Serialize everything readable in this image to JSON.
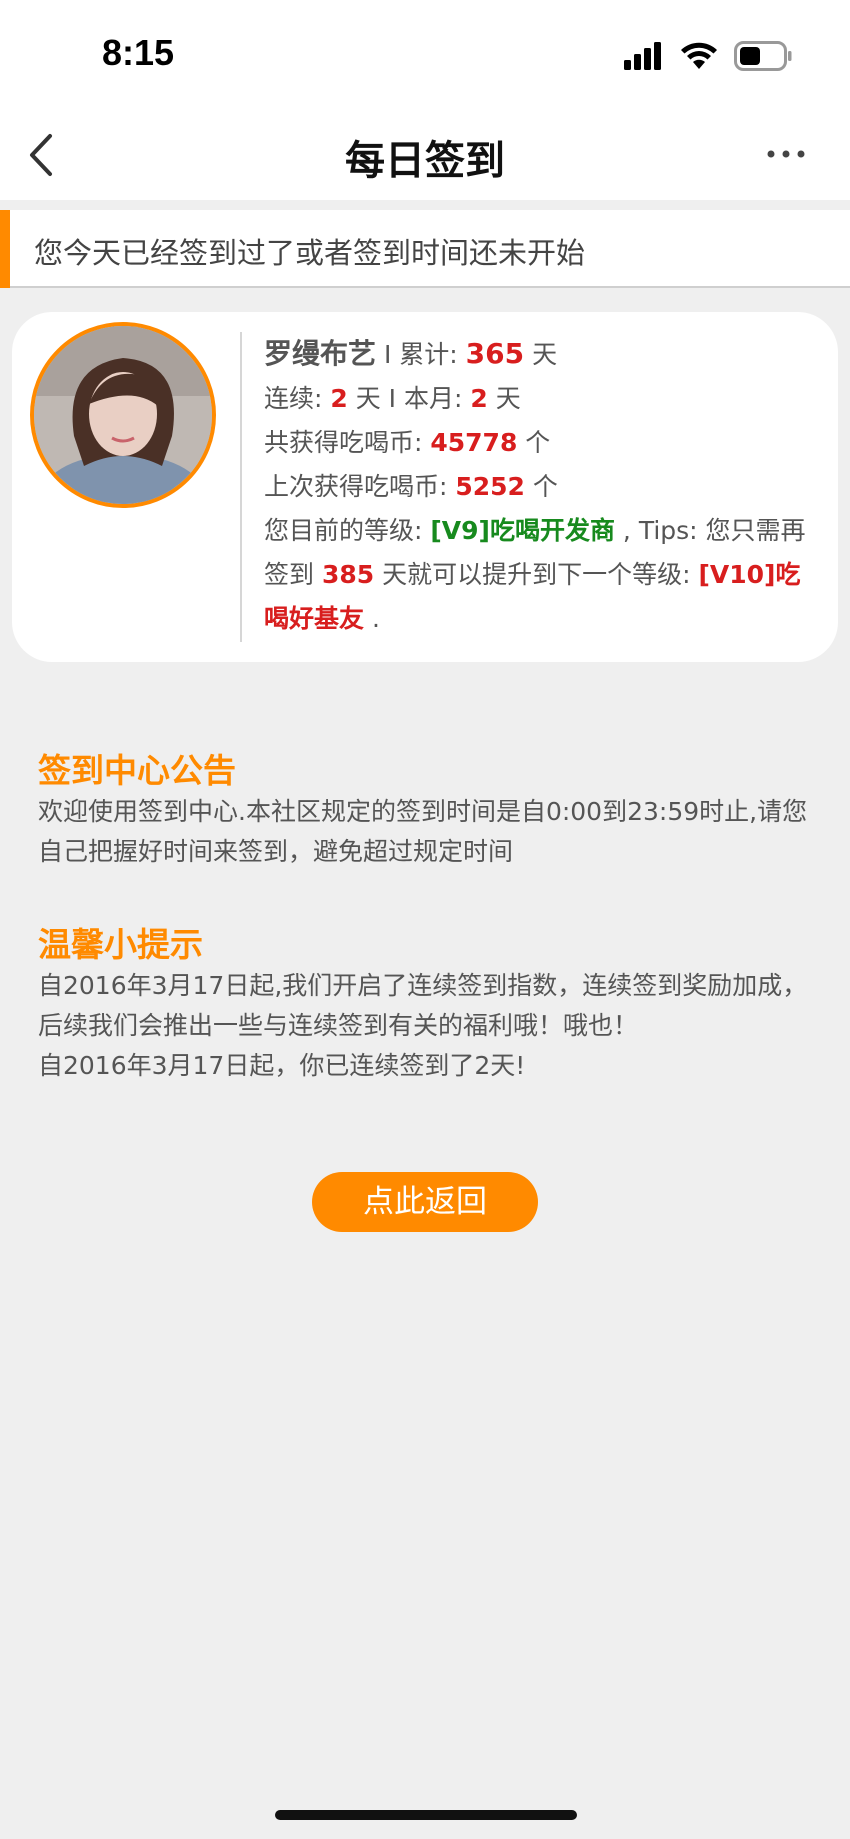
{
  "status": {
    "time": "8:15"
  },
  "nav": {
    "title": "每日签到"
  },
  "notice": {
    "text": "您今天已经签到过了或者签到时间还未开始"
  },
  "profile": {
    "name": "罗缦布艺",
    "sep": " I ",
    "total_label": "累计: ",
    "total_days": "365",
    "day_unit": " 天",
    "streak_label": "连续: ",
    "streak_days": "2",
    "month_label": "本月: ",
    "month_days": "2",
    "coins_label": "共获得吃喝币: ",
    "coins_total": "45778",
    "coins_unit": " 个",
    "last_label": "上次获得吃喝币: ",
    "last_coins": "5252",
    "level_label": "您目前的等级: ",
    "level_current": "[V9]吃喝开发商",
    "tips_prefix": " , Tips: 您只需再签到 ",
    "days_needed": "385",
    "tips_mid": " 天就可以提升到下一个等级: ",
    "level_next": "[V10]吃喝好基友",
    "tips_end": " ."
  },
  "announcement": {
    "title": "签到中心公告",
    "text": "欢迎使用签到中心.本社区规定的签到时间是自0:00到23:59时止,请您自己把握好时间来签到，避免超过规定时间"
  },
  "tips": {
    "title": "温馨小提示",
    "text1": "自2016年3月17日起,我们开启了连续签到指数，连续签到奖励加成，后续我们会推出一些与连续签到有关的福利哦！哦也！",
    "text2": "自2016年3月17日起，你已连续签到了2天!"
  },
  "button": {
    "label": "点此返回"
  },
  "colors": {
    "accent": "#ff8a00",
    "highlight_red": "#d81e1e",
    "highlight_green": "#178a1e"
  }
}
